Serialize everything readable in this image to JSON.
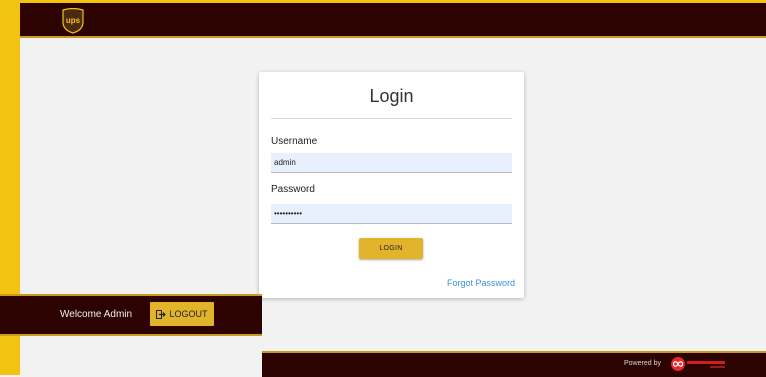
{
  "header": {
    "logo_text": "ups",
    "logo_icon": "ups-shield-logo"
  },
  "login": {
    "title": "Login",
    "username_label": "Username",
    "username_value": "admin",
    "password_label": "Password",
    "password_value": "••••••••••",
    "login_button": "LOGIN",
    "forgot_password": "Forgot Password"
  },
  "user_panel": {
    "welcome": "Welcome Admin",
    "logout_icon": "logout-icon",
    "logout_label": "LOGOUT"
  },
  "footer": {
    "powered_by": "Powered by",
    "brand_name": "infinity-brand-logo"
  },
  "colors": {
    "dark_bar": "#2c0300",
    "accent_yellow": "#f3c312",
    "button_gold": "#e2b42c",
    "link_blue": "#3f8ee5"
  }
}
